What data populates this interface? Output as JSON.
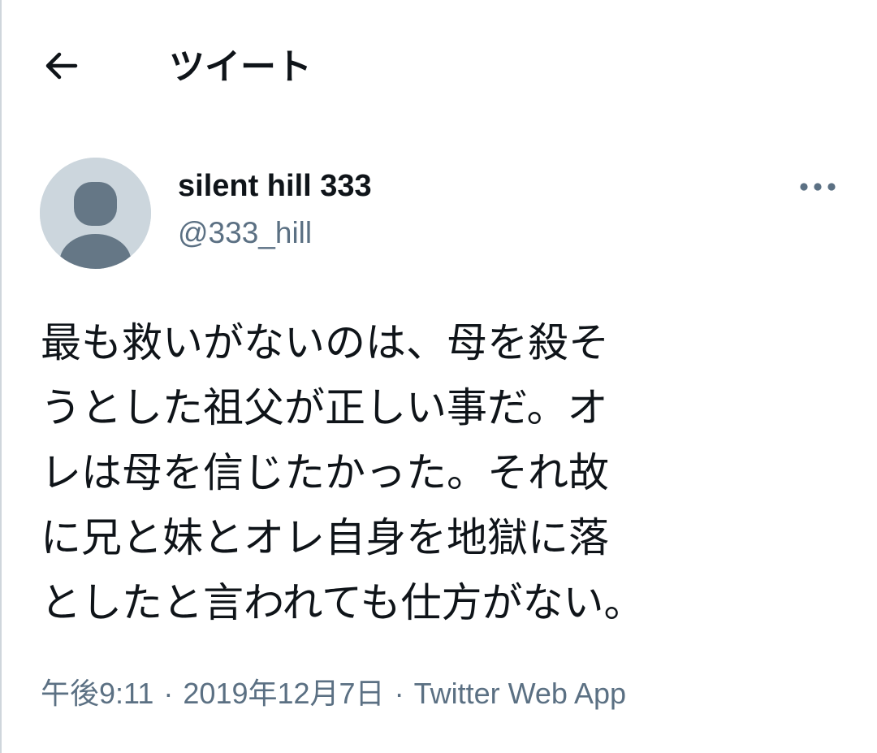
{
  "header": {
    "back_icon": "arrow-left-icon",
    "title": "ツイート"
  },
  "author": {
    "avatar_icon": "default-profile-icon",
    "display_name": "silent hill 333",
    "handle": "@333_hill",
    "more_icon": "more-horizontal-icon"
  },
  "tweet": {
    "lines": [
      "最も救いがないのは、母を殺そ",
      "うとした祖父が正しい事だ。オ",
      "レは母を信じたかった。それ故",
      "に兄と妹とオレ自身を地獄に落",
      "としたと言われても仕方がない。"
    ],
    "time": "午後9:11",
    "separator": "·",
    "date": "2019年12月7日",
    "source": "Twitter Web App"
  },
  "colors": {
    "text_primary": "#0f1419",
    "text_secondary": "#5b7083",
    "avatar_bg": "#ccd6dd",
    "avatar_figure": "#657786"
  }
}
